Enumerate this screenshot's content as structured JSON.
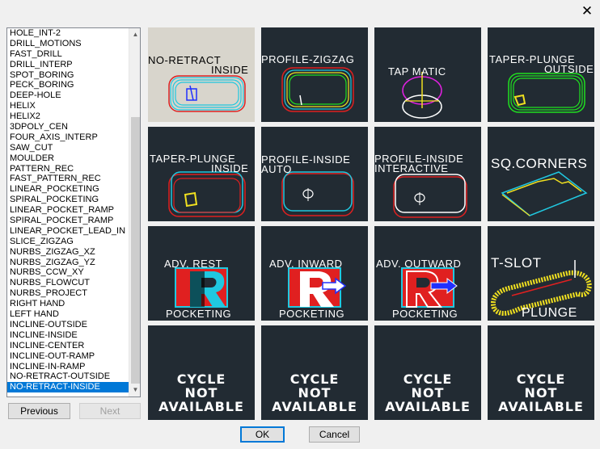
{
  "window": {
    "close_glyph": "✕"
  },
  "list": {
    "items": [
      "HOLE_INT-2",
      "DRILL_MOTIONS",
      "FAST_DRILL",
      "DRILL_INTERP",
      "SPOT_BORING",
      "PECK_BORING",
      "DEEP-HOLE",
      "HELIX",
      "HELIX2",
      "3DPOLY_CEN",
      "FOUR_AXIS_INTERP",
      "SAW_CUT",
      "MOULDER",
      "PATTERN_REC",
      "FAST_PATTERN_REC",
      "LINEAR_POCKETING",
      "SPIRAL_POCKETING",
      "LINEAR_POCKET_RAMP",
      "SPIRAL_POCKET_RAMP",
      "LINEAR_POCKET_LEAD_IN",
      "SLICE_ZIGZAG",
      "NURBS_ZIGZAG_XZ",
      "NURBS_ZIGZAG_YZ",
      "NURBS_CCW_XY",
      "NURBS_FLOWCUT",
      "NURBS_PROJECT",
      "RIGHT HAND",
      "LEFT HAND",
      "INCLINE-OUTSIDE",
      "INCLINE-INSIDE",
      "INCLINE-CENTER",
      "INCLINE-OUT-RAMP",
      "INCLINE-IN-RAMP",
      "NO-RETRACT-OUTSIDE",
      "NO-RETRACT-INSIDE"
    ],
    "selected": "NO-RETRACT-INSIDE"
  },
  "buttons": {
    "previous": "Previous",
    "next": "Next",
    "ok": "OK",
    "cancel": "Cancel"
  },
  "tiles": [
    {
      "line1": "NO-RETRACT",
      "line2": "INSIDE"
    },
    {
      "line1": "PROFILE-ZIGZAG",
      "line2": ""
    },
    {
      "line1": "TAP MATIC",
      "line2": ""
    },
    {
      "line1": "TAPER-PLUNGE",
      "line2": "OUTSIDE"
    },
    {
      "line1": "TAPER-PLUNGE",
      "line2": "INSIDE"
    },
    {
      "line1": "PROFILE-INSIDE",
      "line2": "AUTO"
    },
    {
      "line1": "PROFILE-INSIDE",
      "line2": "INTERACTIVE"
    },
    {
      "line1": "SQ.CORNERS",
      "line2": ""
    },
    {
      "line1": "ADV. REST",
      "line2": "POCKETING"
    },
    {
      "line1": "ADV. INWARD",
      "line2": "POCKETING"
    },
    {
      "line1": "ADV. OUTWARD",
      "line2": "POCKETING"
    },
    {
      "line1": "T-SLOT",
      "line2": "PLUNGE"
    }
  ],
  "not_available": {
    "line1": "CYCLE",
    "line2": "NOT",
    "line3": "AVAILABLE"
  },
  "colors": {
    "selection": "#0078d7",
    "tile_bg": "#222b33",
    "tile_selected_bg": "#d8d5cc",
    "red": "#ff2020",
    "cyan": "#20e0e0",
    "yellow": "#f0e020",
    "green": "#20e020",
    "magenta": "#e020e0"
  }
}
